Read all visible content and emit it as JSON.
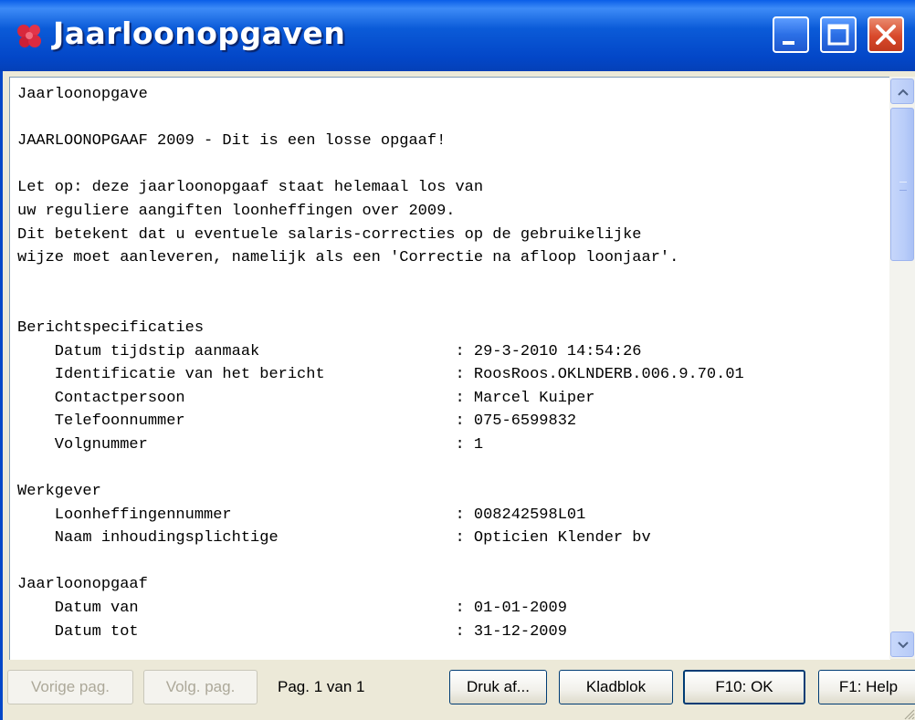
{
  "window": {
    "title": "Jaarloonopgaven",
    "colors": {
      "titlebar": "#0347C8",
      "close": "#D8492B",
      "text_bg": "#FFFFFF"
    }
  },
  "document": {
    "lines": [
      "Jaarloonopgave",
      "",
      "JAARLOONOPGAAF 2009 - Dit is een losse opgaaf!",
      "",
      "Let op: deze jaarloonopgaaf staat helemaal los van",
      "uw reguliere aangiften loonheffingen over 2009.",
      "Dit betekent dat u eventuele salaris-correcties op de gebruikelijke",
      "wijze moet aanleveren, namelijk als een 'Correctie na afloop loonjaar'.",
      "",
      "",
      "Berichtspecificaties",
      "    Datum tijdstip aanmaak                     : 29-3-2010 14:54:26",
      "    Identificatie van het bericht              : RoosRoos.OKLNDERB.006.9.70.01",
      "    Contactpersoon                             : Marcel Kuiper",
      "    Telefoonnummer                             : 075-6599832",
      "    Volgnummer                                 : 1",
      "",
      "Werkgever",
      "    Loonheffingennummer                        : 008242598L01",
      "    Naam inhoudingsplichtige                   : Opticien Klender bv",
      "",
      "Jaarloonopgaaf",
      "    Datum van                                  : 01-01-2009",
      "    Datum tot                                  : 31-12-2009"
    ]
  },
  "footer": {
    "prev_page": "Vorige pag.",
    "next_page": "Volg. pag.",
    "page_indicator": "Pag. 1 van 1",
    "print": "Druk af...",
    "notepad": "Kladblok",
    "ok": "F10: OK",
    "help": "F1: Help"
  }
}
